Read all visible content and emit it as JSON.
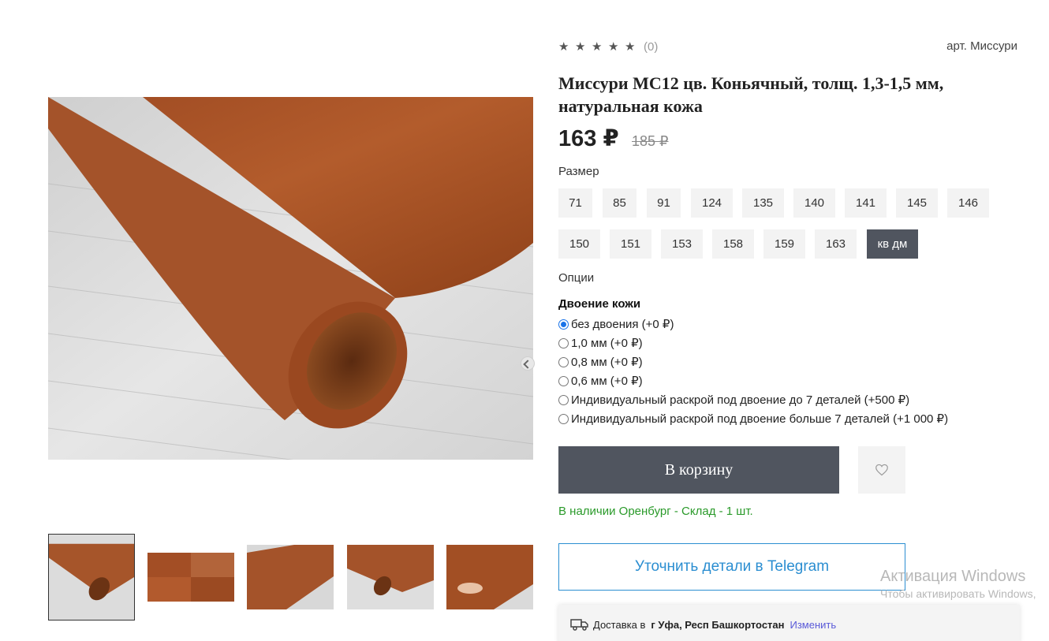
{
  "product": {
    "rating_count": "(0)",
    "sku": "арт. Миссури",
    "title": "Миссури МС12 цв. Коньячный, толщ. 1,3-1,5 мм, натуральная кожа",
    "price": "163 ₽",
    "old_price": "185 ₽",
    "rating_stars": 5
  },
  "sizes": {
    "label": "Размер",
    "items": [
      "71",
      "85",
      "91",
      "124",
      "135",
      "140",
      "141",
      "145",
      "146",
      "150",
      "151",
      "153",
      "158",
      "159",
      "163",
      "кв дм"
    ],
    "selected": "кв дм"
  },
  "options": {
    "label": "Опции",
    "group_title": "Двоение кожи",
    "items": [
      {
        "label": "без двоения (+0 ₽)",
        "checked": true
      },
      {
        "label": "1,0 мм (+0 ₽)",
        "checked": false
      },
      {
        "label": "0,8 мм (+0 ₽)",
        "checked": false
      },
      {
        "label": "0,6 мм (+0 ₽)",
        "checked": false
      },
      {
        "label": "Индивидуальный раскрой под двоение до 7 деталей (+500 ₽)",
        "checked": false
      },
      {
        "label": "Индивидуальный раскрой под двоение больше 7 деталей (+1 000 ₽)",
        "checked": false
      }
    ]
  },
  "actions": {
    "cart_label": "В корзину",
    "wishlist_icon": "heart-icon",
    "telegram_label": "Уточнить детали в Telegram"
  },
  "stock": {
    "text": "В наличии Оренбург - Склад - 1 шт."
  },
  "delivery": {
    "prefix": "Доставка в",
    "city": "г Уфа, Респ Башкортостан",
    "change_label": "Изменить"
  },
  "windows_watermark": {
    "line1": "Активация Windows",
    "line2": "Чтобы активировать Windows,"
  },
  "colors": {
    "button_dark": "#50555f",
    "stock_green": "#2a9a2a",
    "telegram_blue": "#2b8ed1",
    "leather_brown": "#a14f24"
  },
  "thumbnails": [
    "roll-corner",
    "leather-squares",
    "roll-side",
    "roll-fold",
    "hand-bend"
  ]
}
